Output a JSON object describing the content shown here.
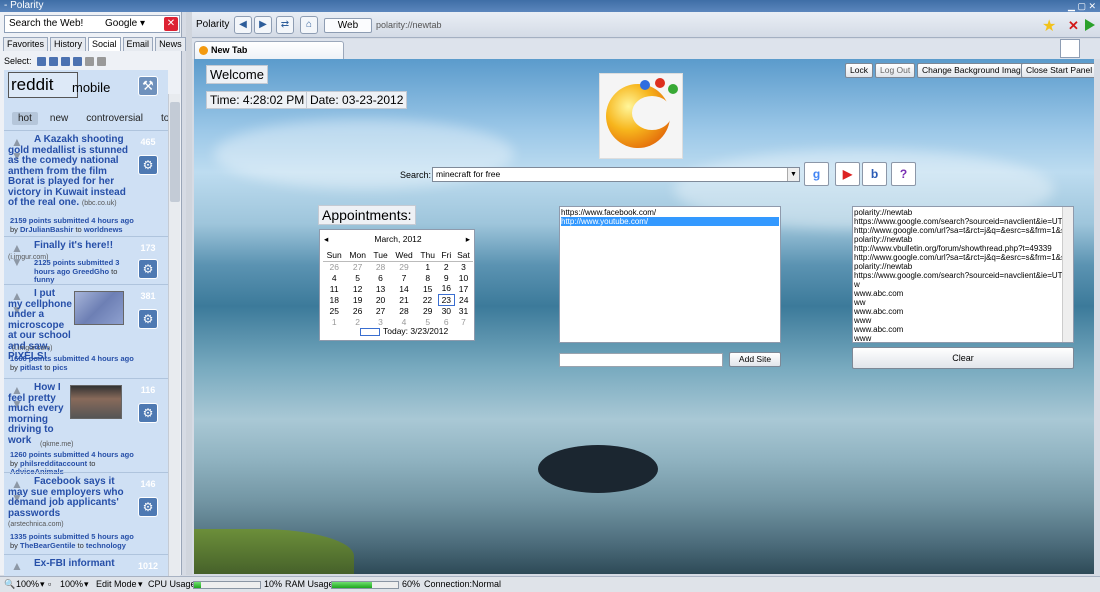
{
  "window": {
    "title": "- Polarity"
  },
  "left": {
    "search": {
      "text": "Search the Web!",
      "engine": "Google"
    },
    "tabs": [
      "Favorites",
      "History",
      "Social",
      "Email",
      "News"
    ],
    "select_label": "Select:",
    "reddit": {
      "logo": "reddit",
      "logo_sub": "mobile",
      "sort_tabs": [
        "hot",
        "new",
        "controversial",
        "top"
      ],
      "posts": [
        {
          "title": "A Kazakh shooting gold medallist is stunned as the comedy national anthem from the film Borat is played for her victory in Kuwait instead of the real one.",
          "domain": "(bbc.co.uk)",
          "score": "465",
          "meta": "2159 points submitted 4 hours ago",
          "by": "DrJulianBashir",
          "to": "worldnews"
        },
        {
          "title": "Finally it's here!!",
          "domain": "(i.imgur.com)",
          "score": "173",
          "meta": "2125 points submitted 3 hours ago",
          "by": "GreedGho",
          "to": "funny"
        },
        {
          "title": "I put my cellphone under a microscope at our school and saw, PIXELS!",
          "domain": "(i.imgur.com)",
          "score": "381",
          "meta": "1666 points submitted 4 hours ago",
          "by": "pitlast",
          "to": "pics"
        },
        {
          "title": "How I feel pretty much every morning driving to work",
          "domain": "(qkme.me)",
          "score": "116",
          "meta": "1260 points submitted 4 hours ago",
          "by": "philsredditaccount",
          "to": "AdviceAnimals"
        },
        {
          "title": "Facebook says it may sue employers who demand job applicants' passwords",
          "domain": "(arstechnica.com)",
          "score": "146",
          "meta": "1335 points submitted 5 hours ago",
          "by": "TheBearGentile",
          "to": "technology"
        },
        {
          "title": "Ex-FBI informant",
          "score": "1012"
        }
      ]
    }
  },
  "nav": {
    "app": "Polarity",
    "web_button": "Web",
    "url": "polarity://newtab"
  },
  "tab": {
    "title": "New Tab"
  },
  "page": {
    "welcome": "Welcome",
    "time": "Time: 4:28:02 PM",
    "date": "Date: 03-23-2012",
    "buttons": [
      "Lock",
      "Log Out",
      "Change Background Image",
      "Close Start Panel"
    ],
    "search_label": "Search:",
    "search_value": "minecraft for free",
    "appointments": "Appointments:",
    "calendar": {
      "month": "March, 2012",
      "days": [
        "Sun",
        "Mon",
        "Tue",
        "Wed",
        "Thu",
        "Fri",
        "Sat"
      ],
      "weeks": [
        [
          "26",
          "27",
          "28",
          "29",
          "1",
          "2",
          "3"
        ],
        [
          "4",
          "5",
          "6",
          "7",
          "8",
          "9",
          "10"
        ],
        [
          "11",
          "12",
          "13",
          "14",
          "15",
          "16",
          "17"
        ],
        [
          "18",
          "19",
          "20",
          "21",
          "22",
          "23",
          "24"
        ],
        [
          "25",
          "26",
          "27",
          "28",
          "29",
          "30",
          "31"
        ],
        [
          "1",
          "2",
          "3",
          "4",
          "5",
          "6",
          "7"
        ]
      ],
      "today": "Today: 3/23/2012"
    },
    "sites": [
      "https://www.facebook.com/",
      "http://www.youtube.com/"
    ],
    "add_site": "Add Site",
    "history": [
      "polarity://newtab",
      "https://www.google.com/search?sourceid=navclient&ie=UTF-8",
      "http://www.google.com/url?sa=t&rct=j&q=&esrc=s&frm=1&sourc",
      "polarity://newtab",
      "http://www.vbulletin.org/forum/showthread.php?t=49339",
      "http://www.google.com/url?sa=t&rct=j&q=&esrc=s&frm=1&sourc",
      "polarity://newtab",
      "https://www.google.com/search?sourceid=navclient&ie=UTF-8",
      "w",
      "www.abc.com",
      "ww",
      "www.abc.com",
      "www",
      "www.abc.com",
      "www"
    ],
    "clear": "Clear"
  },
  "status": {
    "zoom1": "100%",
    "zoom2": "100%",
    "mode": "Edit Mode",
    "cpu_label": "CPU Usage:",
    "cpu": "10%",
    "cpu_frac": 0.1,
    "ram_label": "RAM Usage:",
    "ram": "60%",
    "ram_frac": 0.6,
    "conn": "Connection:Normal"
  }
}
